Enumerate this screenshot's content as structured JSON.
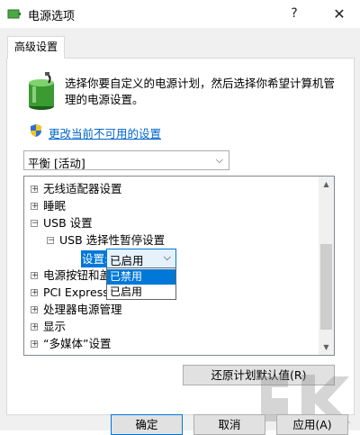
{
  "window": {
    "title": "电源选项",
    "help_glyph": "?",
    "close_glyph": "✕"
  },
  "tabs": [
    {
      "label": "高级设置"
    }
  ],
  "description": "选择你要自定义的电源计划，然后选择你希望计算机管理的电源设置。",
  "link": {
    "label": "更改当前不可用的设置"
  },
  "plan_select": {
    "value": "平衡 [活动]"
  },
  "tree": {
    "items": [
      {
        "label": "无线适配器设置",
        "expander": "+"
      },
      {
        "label": "睡眠",
        "expander": "+"
      },
      {
        "label": "USB 设置",
        "expander": "−"
      },
      {
        "label": "USB 选择性暂停设置",
        "expander": "−"
      },
      {
        "label": "电源按钮和盖",
        "expander": "+"
      },
      {
        "label": "PCI Express",
        "expander": "+"
      },
      {
        "label": "处理器电源管理",
        "expander": "+"
      },
      {
        "label": "显示",
        "expander": "+"
      },
      {
        "label": "“多媒体”设置",
        "expander": "+"
      }
    ],
    "setting": {
      "label": "设置:",
      "value": "已启用",
      "options": [
        "已禁用",
        "已启用"
      ]
    }
  },
  "buttons": {
    "restore": "还原计划默认值(R)",
    "ok": "确定",
    "cancel": "取消",
    "apply": "应用(A)"
  },
  "colors": {
    "accent": "#0078d7",
    "link": "#0066cc",
    "dialog_bg": "#f0f0f0"
  }
}
